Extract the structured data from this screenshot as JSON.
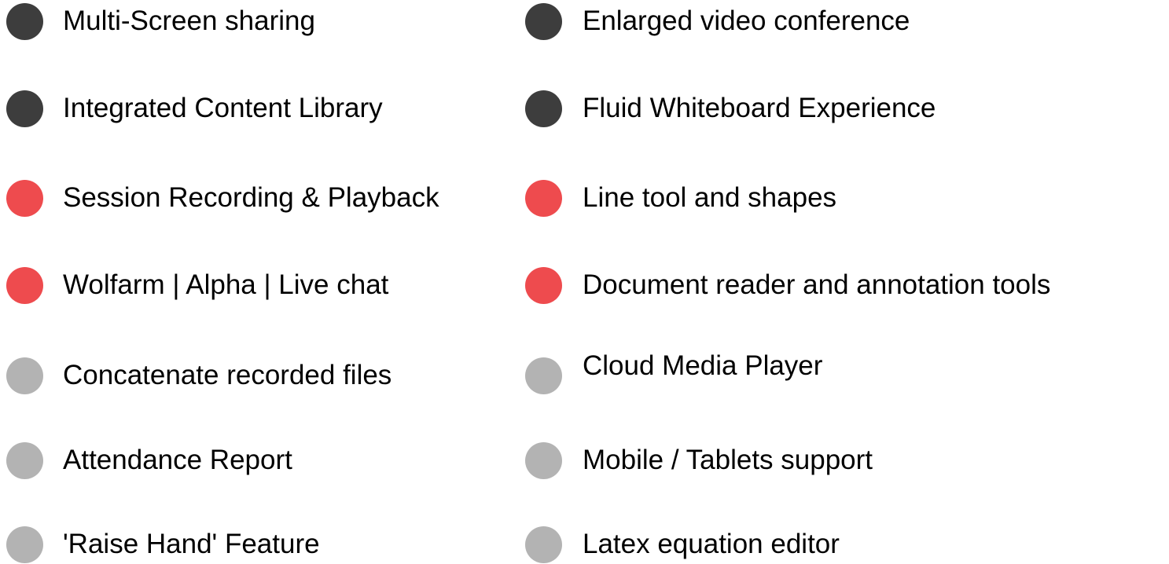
{
  "colors": {
    "dark": "#3d3d3d",
    "red": "#ee4b4e",
    "gray": "#b3b3b3"
  },
  "features": {
    "left": [
      {
        "label": "Multi-Screen sharing",
        "color": "dark"
      },
      {
        "label": "Integrated Content Library",
        "color": "dark"
      },
      {
        "label": "Session Recording & Playback",
        "color": "red"
      },
      {
        "label": "Wolfarm | Alpha | Live chat",
        "color": "red"
      },
      {
        "label": "Concatenate recorded files",
        "color": "gray"
      },
      {
        "label": "Attendance Report",
        "color": "gray"
      },
      {
        "label": "'Raise Hand' Feature",
        "color": "gray"
      }
    ],
    "right": [
      {
        "label": "Enlarged video conference",
        "color": "dark"
      },
      {
        "label": "Fluid Whiteboard Experience",
        "color": "dark"
      },
      {
        "label": "Line tool and shapes",
        "color": "red"
      },
      {
        "label": "Document reader and annotation tools",
        "color": "red"
      },
      {
        "label": "Cloud Media Player",
        "color": "gray"
      },
      {
        "label": "Mobile / Tablets support",
        "color": "gray"
      },
      {
        "label": "Latex equation editor",
        "color": "gray"
      }
    ]
  }
}
